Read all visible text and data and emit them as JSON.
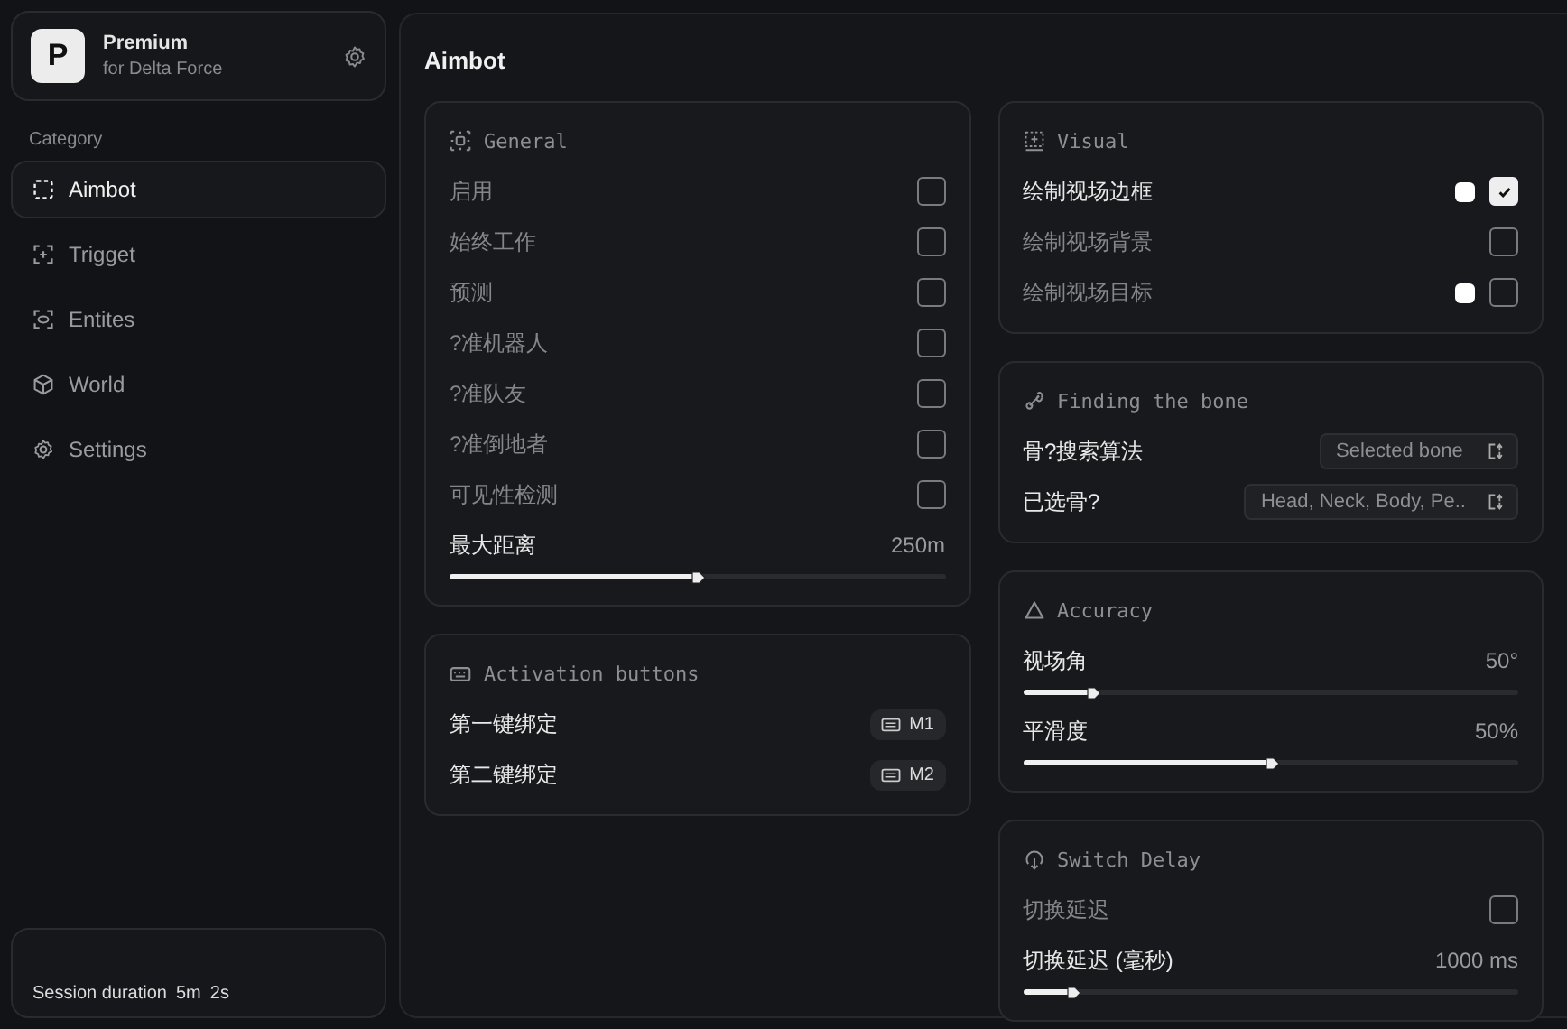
{
  "brand": {
    "name": "Premium",
    "subtitle": "for Delta Force",
    "logo": "P"
  },
  "sidebar": {
    "heading": "Category",
    "items": [
      {
        "label": "Aimbot",
        "selected": true
      },
      {
        "label": "Trigget",
        "selected": false
      },
      {
        "label": "Entites",
        "selected": false
      },
      {
        "label": "World",
        "selected": false
      },
      {
        "label": "Settings",
        "selected": false
      }
    ]
  },
  "session": {
    "label": "Session duration",
    "parts": [
      "5m",
      "2s"
    ]
  },
  "page_title": "Aimbot",
  "columns": [
    [
      {
        "title": "General",
        "rows": [
          {
            "kind": "checkbox",
            "label": "启用",
            "checked": false
          },
          {
            "kind": "checkbox",
            "label": "始终工作",
            "checked": false
          },
          {
            "kind": "checkbox",
            "label": "预测",
            "checked": false
          },
          {
            "kind": "checkbox",
            "label": "?准机器人",
            "checked": false
          },
          {
            "kind": "checkbox",
            "label": "?准队友",
            "checked": false
          },
          {
            "kind": "checkbox",
            "label": "?准倒地者",
            "checked": false
          },
          {
            "kind": "checkbox",
            "label": "可见性检测",
            "checked": false
          },
          {
            "kind": "slider",
            "label": "最大距离",
            "value": "250m",
            "level": 0.5
          }
        ]
      },
      {
        "title": "Activation buttons",
        "rows": [
          {
            "kind": "keybind",
            "label": "第一键绑定",
            "key": "M1"
          },
          {
            "kind": "keybind",
            "label": "第二键绑定",
            "key": "M2"
          }
        ]
      }
    ],
    [
      {
        "title": "Visual",
        "rows": [
          {
            "kind": "checkbox",
            "label": "绘制视场边框",
            "checked": true,
            "color": "#ffffff"
          },
          {
            "kind": "checkbox",
            "label": "绘制视场背景",
            "checked": false
          },
          {
            "kind": "checkbox",
            "label": "绘制视场目标",
            "checked": false,
            "color": "#ffffff"
          }
        ]
      },
      {
        "title": "Finding the bone",
        "rows": [
          {
            "kind": "select",
            "label": "骨?搜索算法",
            "value": "Selected bone"
          },
          {
            "kind": "select",
            "label": "已选骨?",
            "value": "Head, Neck, Body, Pe.."
          }
        ]
      },
      {
        "title": "Accuracy",
        "rows": [
          {
            "kind": "slider",
            "label": "视场角",
            "value": "50°",
            "level": 0.14
          },
          {
            "kind": "slider",
            "label": "平滑度",
            "value": "50%",
            "level": 0.5
          }
        ]
      },
      {
        "title": "Switch Delay",
        "rows": [
          {
            "kind": "checkbox",
            "label": "切换延迟",
            "checked": false
          },
          {
            "kind": "slider",
            "label": "切换延迟 (毫秒)",
            "value": "1000 ms",
            "level": 0.1
          }
        ]
      }
    ]
  ]
}
